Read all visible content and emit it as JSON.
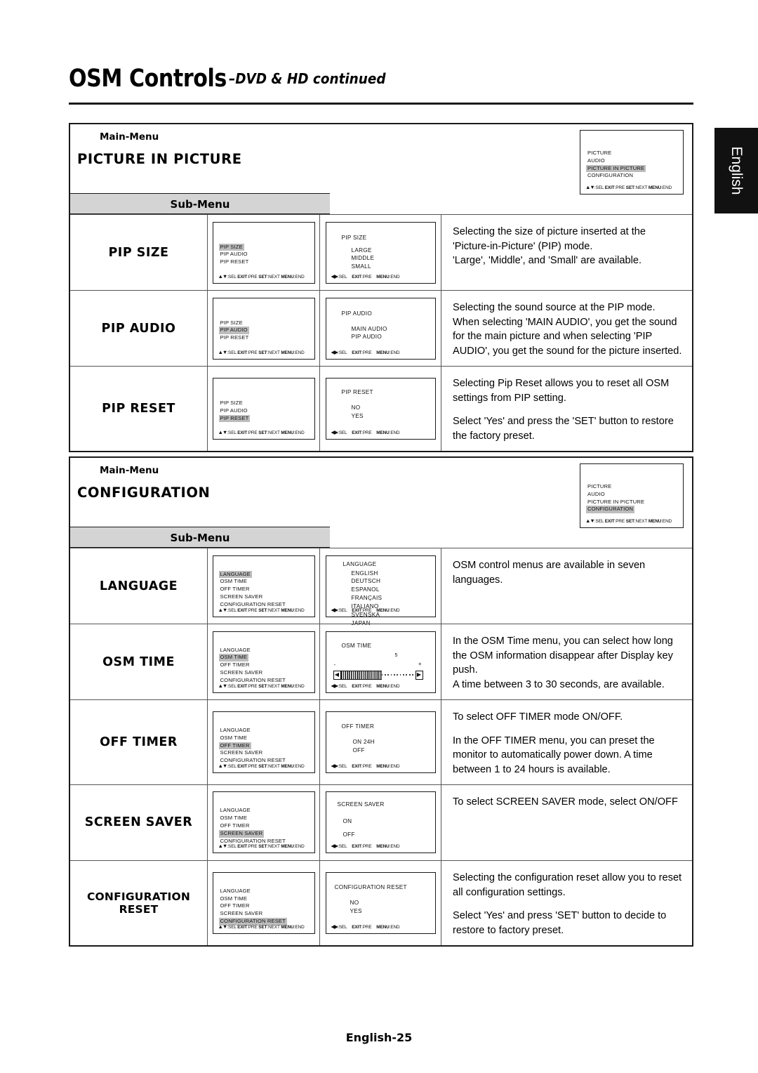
{
  "header": {
    "title": "OSM Controls",
    "subtitle": "–DVD & HD continued"
  },
  "language_tab": {
    "label": "English"
  },
  "footer": {
    "page_label": "English-25"
  },
  "labels": {
    "main_menu": "Main-Menu",
    "sub_menu": "Sub-Menu"
  },
  "osd_footers": {
    "updown": "▲▼:SEL EXIT:PRE SET:NEXT MENU:END",
    "leftright": "◀▶:SEL      EXIT:PRE      MENU:END"
  },
  "sections": [
    {
      "main_menu_label": "Main-Menu",
      "title": "PICTURE IN PICTURE",
      "sub_menu_label": "Sub-Menu",
      "main_osd": {
        "items": [
          "PICTURE",
          "AUDIO",
          "PICTURE IN PICTURE",
          "CONFIGURATION"
        ],
        "highlight": "PICTURE IN PICTURE",
        "footer": "▲▼:SEL EXIT:PRE SET:NEXT MENU:END"
      },
      "rows": [
        {
          "label": "PIP SIZE",
          "osd_list": {
            "items": [
              "PIP SIZE",
              "PIP AUDIO",
              "PIP RESET"
            ],
            "highlight": "PIP SIZE",
            "footer": "▲▼:SEL EXIT:PRE SET:NEXT MENU:END"
          },
          "osd_detail": {
            "title": "PIP SIZE",
            "options": [
              "LARGE",
              "MIDDLE",
              "SMALL"
            ],
            "footer": "◀▶:SEL      EXIT:PRE      MENU:END"
          },
          "description": [
            "Selecting the size of picture inserted at the 'Picture-in-Picture' (PIP) mode.",
            "'Large', 'Middle', and 'Small' are available."
          ]
        },
        {
          "label": "PIP AUDIO",
          "osd_list": {
            "items": [
              "PIP SIZE",
              "PIP AUDIO",
              "PIP RESET"
            ],
            "highlight": "PIP AUDIO",
            "footer": "▲▼:SEL EXIT:PRE SET:NEXT MENU:END"
          },
          "osd_detail": {
            "title": "PIP AUDIO",
            "options": [
              "MAIN AUDIO",
              "PIP AUDIO"
            ],
            "footer": "◀▶:SEL      EXIT:PRE      MENU:END"
          },
          "description": [
            "Selecting the sound source at the PIP mode. When selecting 'MAIN AUDIO', you get the sound for the main picture and when selecting 'PIP AUDIO', you get the sound for the picture inserted."
          ]
        },
        {
          "label": "PIP RESET",
          "osd_list": {
            "items": [
              "PIP SIZE",
              "PIP AUDIO",
              "PIP RESET"
            ],
            "highlight": "PIP RESET",
            "footer": "▲▼:SEL EXIT:PRE SET:NEXT MENU:END"
          },
          "osd_detail": {
            "title": "PIP RESET",
            "options": [
              "NO",
              "YES"
            ],
            "footer": "◀▶:SEL      EXIT:PRE      MENU:END"
          },
          "description": [
            "Selecting Pip Reset allows you to reset all OSM settings from PIP setting.",
            "Select 'Yes' and press the 'SET' button to restore the factory preset."
          ]
        }
      ]
    },
    {
      "main_menu_label": "Main-Menu",
      "title": "CONFIGURATION",
      "sub_menu_label": "Sub-Menu",
      "main_osd": {
        "items": [
          "PICTURE",
          "AUDIO",
          "PICTURE IN PICTURE",
          "CONFIGURATION"
        ],
        "highlight": "CONFIGURATION",
        "footer": "▲▼:SEL EXIT:PRE SET:NEXT MENU:END"
      },
      "rows": [
        {
          "label": "LANGUAGE",
          "osd_list": {
            "items": [
              "LANGUAGE",
              "OSM TIME",
              "OFF TIMER",
              "SCREEN SAVER",
              "CONFIGURATION RESET"
            ],
            "highlight": "LANGUAGE",
            "footer": "▲▼:SEL EXIT:PRE SET:NEXT MENU:END"
          },
          "osd_detail": {
            "title": "LANGUAGE",
            "options": [
              "ENGLISH",
              "DEUTSCH",
              "ESPANOL",
              "FRANÇAIS",
              "ITALIANO",
              "SVENSKA",
              "JAPAN"
            ],
            "footer": "◀▶:SEL      EXIT:PRE      MENU:END"
          },
          "description": [
            "OSM control menus are available in seven languages."
          ]
        },
        {
          "label": "OSM TIME",
          "osd_list": {
            "items": [
              "LANGUAGE",
              "OSM TIME",
              "OFF TIMER",
              "SCREEN SAVER",
              "CONFIGURATION RESET"
            ],
            "highlight": "OSM TIME",
            "footer": "▲▼:SEL EXIT:PRE SET:NEXT MENU:END"
          },
          "osd_detail": {
            "title": "OSM TIME",
            "slider": {
              "value": "5",
              "minus": "-",
              "plus": "+"
            },
            "footer": "◀▶:SEL      EXIT:PRE      MENU:END"
          },
          "description": [
            "In the OSM Time menu, you can select how long the OSM information disappear after Display key push.",
            "A time between 3 to 30 seconds, are available."
          ]
        },
        {
          "label": "OFF TIMER",
          "osd_list": {
            "items": [
              "LANGUAGE",
              "OSM TIME",
              "OFF TIMER",
              "SCREEN SAVER",
              "CONFIGURATION RESET"
            ],
            "highlight": "OFF TIMER",
            "footer": "▲▼:SEL EXIT:PRE SET:NEXT MENU:END"
          },
          "osd_detail": {
            "title": "OFF TIMER",
            "options": [
              "ON        24H",
              "OFF"
            ],
            "footer": "◀▶:SEL      EXIT:PRE      MENU:END"
          },
          "description": [
            "To select OFF TIMER mode ON/OFF.",
            "In the OFF TIMER menu, you can preset the monitor to automatically power down. A time between 1 to 24 hours is available."
          ]
        },
        {
          "label": "SCREEN SAVER",
          "osd_list": {
            "items": [
              "LANGUAGE",
              "OSM TIME",
              "OFF TIMER",
              "SCREEN SAVER",
              "CONFIGURATION RESET"
            ],
            "highlight": "SCREEN SAVER",
            "footer": "▲▼:SEL EXIT:PRE SET:NEXT MENU:END"
          },
          "osd_detail": {
            "title": "SCREEN SAVER",
            "options": [
              "ON",
              "OFF"
            ],
            "footer": "◀▶:SEL      EXIT:PRE      MENU:END"
          },
          "description": [
            "To select SCREEN SAVER mode, select ON/OFF"
          ]
        },
        {
          "label": "CONFIGURATION RESET",
          "osd_list": {
            "items": [
              "LANGUAGE",
              "OSM TIME",
              "OFF TIMER",
              "SCREEN SAVER",
              "CONFIGURATION RESET"
            ],
            "highlight": "CONFIGURATION RESET",
            "footer": "▲▼:SEL EXIT:PRE SET:NEXT MENU:END"
          },
          "osd_detail": {
            "title": "CONFIGURATION RESET",
            "options": [
              "NO",
              "YES"
            ],
            "footer": "◀▶:SEL      EXIT:PRE      MENU:END"
          },
          "description": [
            "Selecting the configuration reset allow you to reset all configuration settings.",
            "Select 'Yes' and press 'SET' button to decide to restore to factory preset."
          ]
        }
      ]
    }
  ]
}
